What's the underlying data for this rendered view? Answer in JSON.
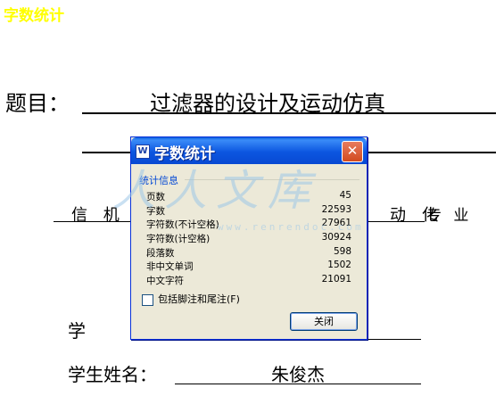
{
  "document": {
    "top_title": "字数统计",
    "title_label": "题目：",
    "title_value": "过滤器的设计及运动仿真",
    "major_left": "信 机",
    "major_right": "动 化",
    "major_suffix": "专 业",
    "student_prefix": "学",
    "name_label": "学生姓名：",
    "name_value": "朱俊杰"
  },
  "watermark": {
    "text": "人人文库",
    "url": "www.renrendoc.com"
  },
  "dialog": {
    "title": "字数统计",
    "close_glyph": "✕",
    "group_label": "统计信息",
    "stats": [
      {
        "label": "页数",
        "value": "45"
      },
      {
        "label": "字数",
        "value": "22593"
      },
      {
        "label": "字符数(不计空格)",
        "value": "27961"
      },
      {
        "label": "字符数(计空格)",
        "value": "30924"
      },
      {
        "label": "段落数",
        "value": "598"
      },
      {
        "label": "非中文单词",
        "value": "1502"
      },
      {
        "label": "中文字符",
        "value": "21091"
      }
    ],
    "checkbox_label": "包括脚注和尾注(F)",
    "checkbox_checked": false,
    "close_button": "关闭"
  },
  "colors": {
    "titlebar": "#0a5fde",
    "dialog_bg": "#ece9d8",
    "top_title": "#ffff00",
    "close_button_red": "#d24a1f"
  }
}
